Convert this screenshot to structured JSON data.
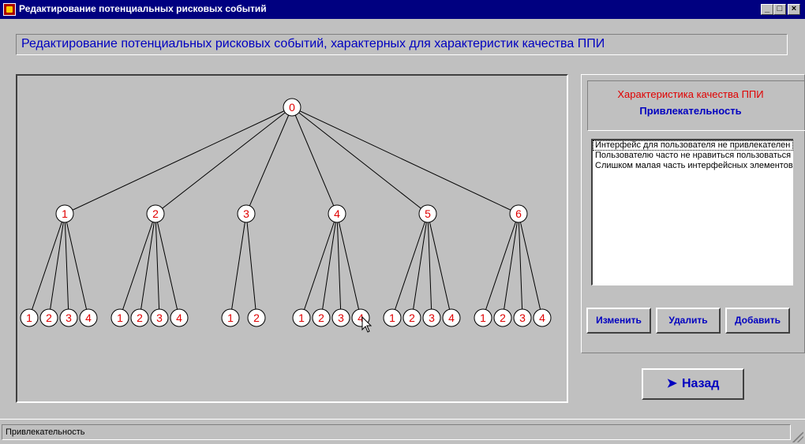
{
  "window": {
    "title": "Редактирование потенциальных рисковых событий",
    "icon": "app-icon",
    "controls": {
      "minimize": "_",
      "maximize": "□",
      "close": "×"
    }
  },
  "header": {
    "text": "Редактирование  потенциальных рисковых событий, характерных для характеристик качества ППИ"
  },
  "tree": {
    "root": {
      "label": "0"
    },
    "branches": [
      {
        "label": "1",
        "children": [
          "1",
          "2",
          "3",
          "4"
        ]
      },
      {
        "label": "2",
        "children": [
          "1",
          "2",
          "3",
          "4"
        ]
      },
      {
        "label": "3",
        "children": [
          "1",
          "2"
        ]
      },
      {
        "label": "4",
        "children": [
          "1",
          "2",
          "3",
          "4"
        ]
      },
      {
        "label": "5",
        "children": [
          "1",
          "2",
          "3",
          "4"
        ]
      },
      {
        "label": "6",
        "children": [
          "1",
          "2",
          "3",
          "4"
        ]
      }
    ],
    "node_text_color": "#e00000",
    "node_fill": "#ffffff"
  },
  "characteristic": {
    "label": "Характеристика качества ППИ",
    "value": "Привлекательность"
  },
  "risk_list": {
    "items": [
      "Интерфейс для пользователя не привлекателен",
      "Пользователю часто  не нравиться пользоваться",
      "Слишком малая часть интерфейсных элементов"
    ]
  },
  "buttons": {
    "edit": "Изменить",
    "delete": "Удалить",
    "add": "Добавить",
    "back": "Назад",
    "back_icon": "back-arrow-icon"
  },
  "status": {
    "text": "Привлекательность"
  },
  "colors": {
    "background": "#c0c0c0",
    "title_bar": "#000080",
    "accent_blue": "#0000c0",
    "accent_red": "#e00000"
  }
}
